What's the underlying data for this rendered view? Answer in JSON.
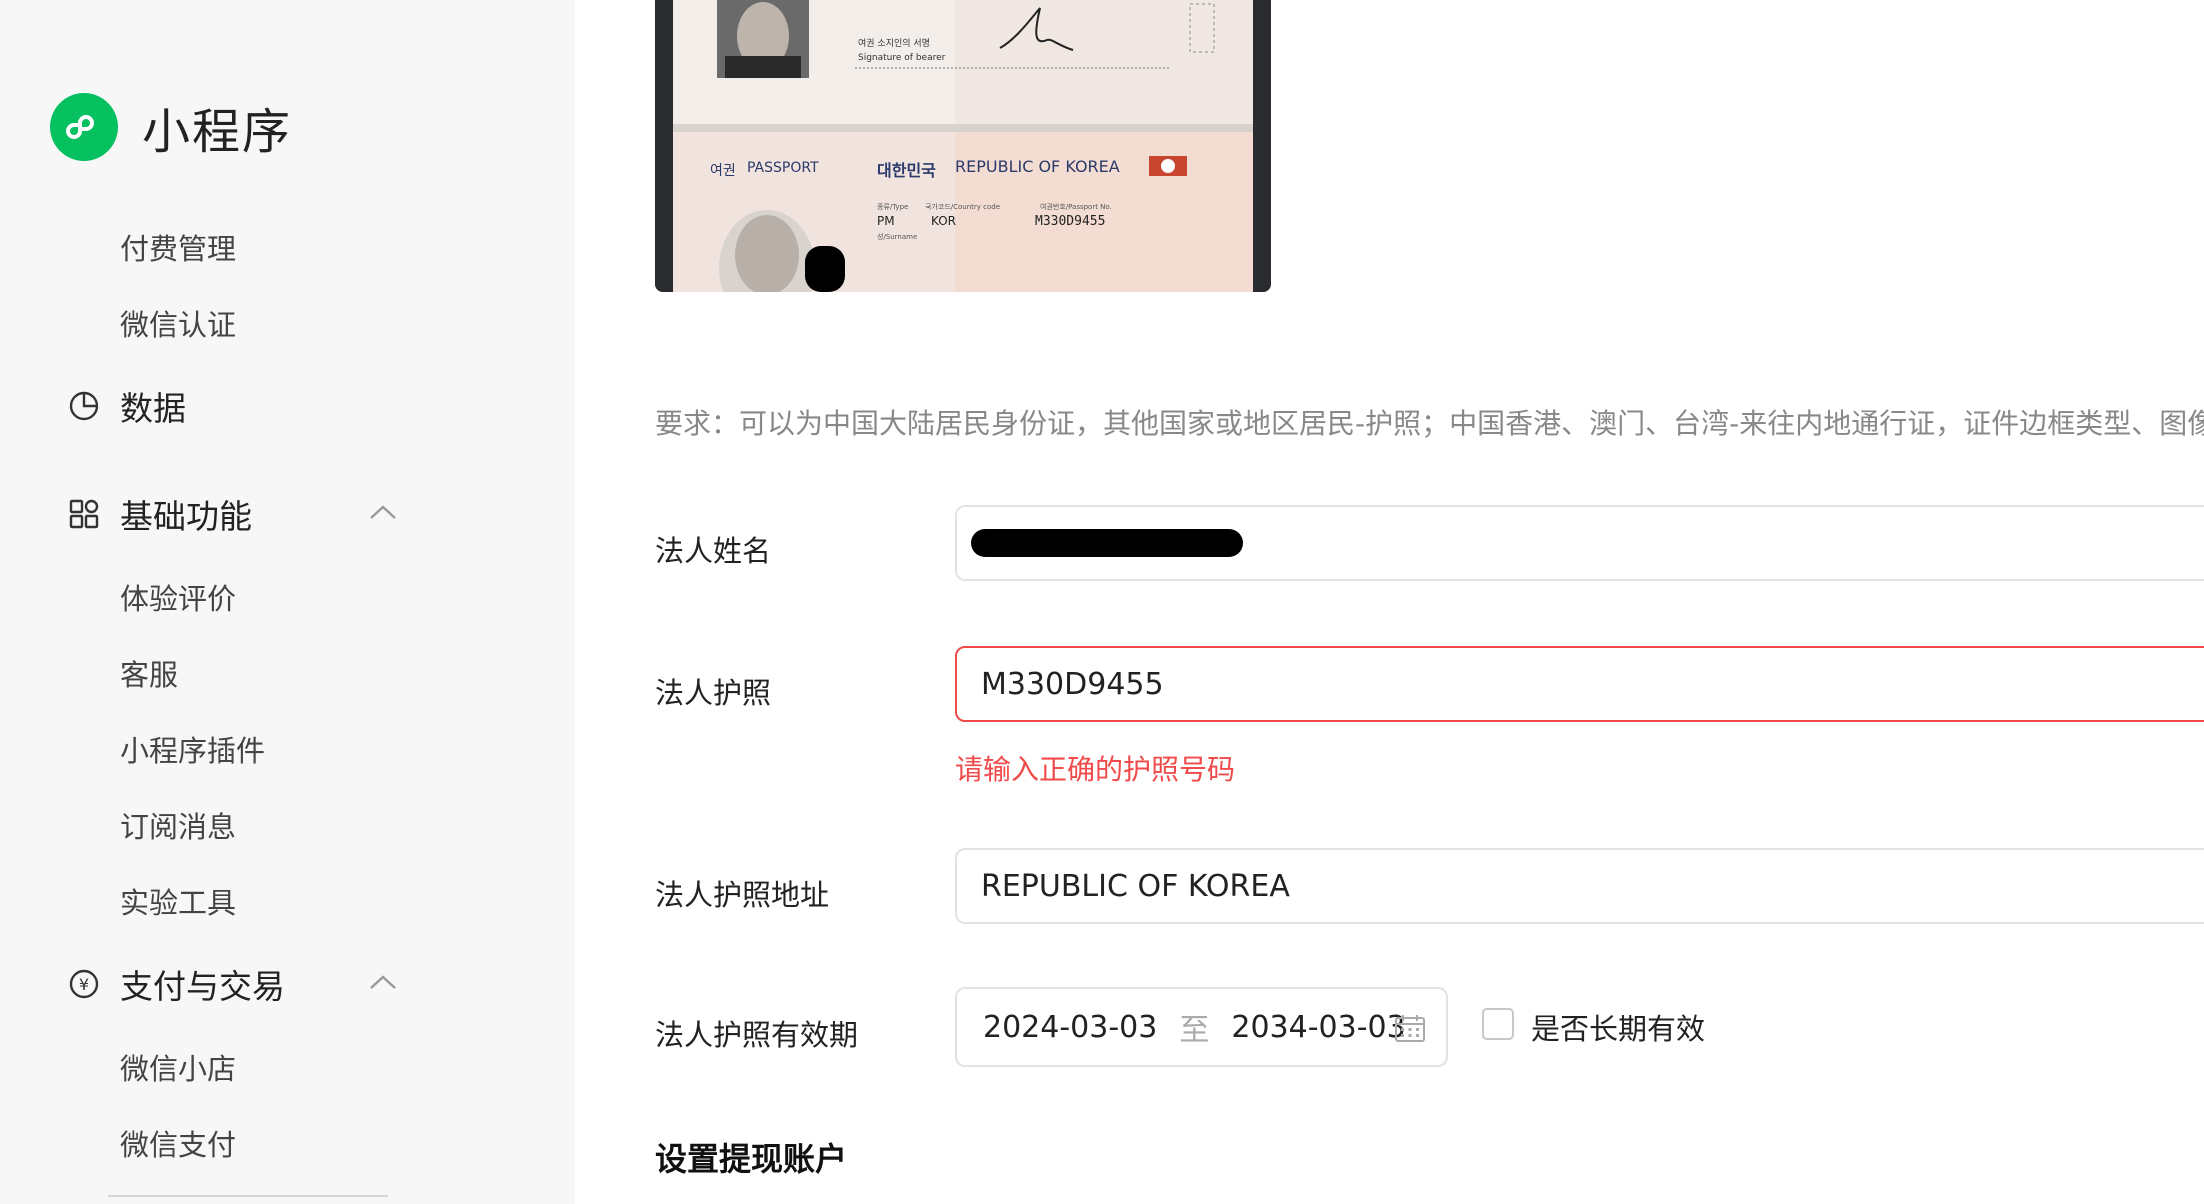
{
  "sidebar": {
    "app_title": "小程序",
    "items_top": [
      "付费管理",
      "微信认证"
    ],
    "data_group": "数据",
    "basic_group": "基础功能",
    "basic_items": [
      "体验评价",
      "客服",
      "小程序插件",
      "订阅消息",
      "实验工具"
    ],
    "pay_group": "支付与交易",
    "pay_items": [
      "微信小店",
      "微信支付"
    ]
  },
  "passport": {
    "upper_label_kr": "여권 소지인의 서명",
    "upper_label_en": "Signature of bearer",
    "header_kr": "여권",
    "header_en": "PASSPORT",
    "country_kr": "대한민국",
    "country_en": "REPUBLIC OF KOREA",
    "field_type_label": "종류/Type",
    "field_country_label": "국가코드/Country code",
    "field_no_label": "여권번호/Passport No.",
    "type_value": "PM",
    "country_value": "KOR",
    "passport_no": "M330D9455",
    "surname_label": "성/Surname"
  },
  "form": {
    "requirement": "要求：可以为中国大陆居民身份证，其他国家或地区居民-护照；中国香港、澳门、台湾-来往内地通行证，证件边框类型、图像",
    "name_label": "法人姓名",
    "passport_label": "法人护照",
    "passport_value": "M330D9455",
    "passport_error": "请输入正确的护照号码",
    "address_label": "法人护照地址",
    "address_value": "REPUBLIC OF KOREA",
    "validity_label": "法人护照有效期",
    "date_start": "2024-03-03",
    "date_sep": "至",
    "date_end": "2034-03-03",
    "long_term_label": "是否长期有效",
    "section_title": "设置提现账户"
  },
  "colors": {
    "brand_green": "#07c160",
    "error_red": "#f04a4a",
    "sidebar_bg": "#f7f7f7"
  }
}
